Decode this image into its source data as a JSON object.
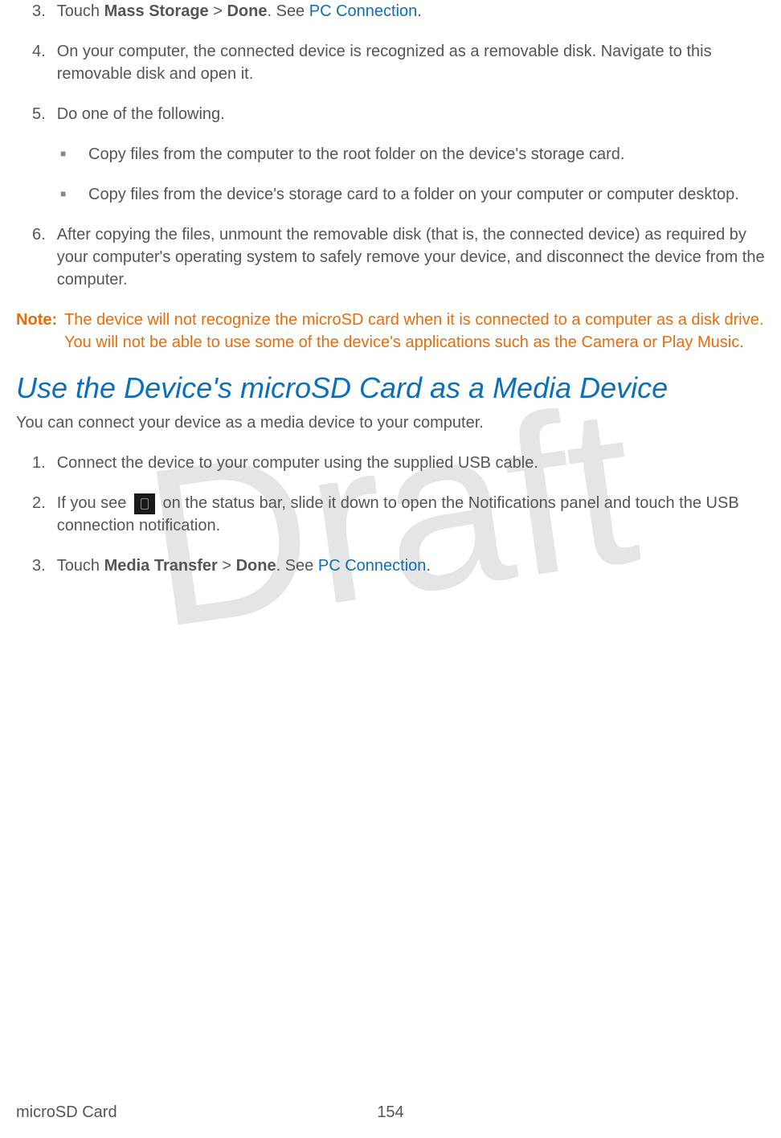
{
  "watermark": "Draft",
  "steps": {
    "s3_num": "3.",
    "s3_prefix": "Touch ",
    "s3_bold1": "Mass Storage",
    "s3_mid": " > ",
    "s3_bold2": "Done",
    "s3_after": ". See ",
    "s3_link": "PC Connection",
    "s3_end": ".",
    "s4_num": "4.",
    "s4_text": "On your computer, the connected device is recognized as a removable disk. Navigate to this removable disk and open it.",
    "s5_num": "5.",
    "s5_text": "Do one of the following.",
    "s5b1": "Copy files from the computer to the root folder on the device's storage card.",
    "s5b2": "Copy files from the device's storage card to a folder on your computer or computer desktop.",
    "s6_num": "6.",
    "s6_text": "After copying the files, unmount the removable disk (that is, the connected device) as required by your computer's operating system to safely remove your device, and disconnect the device from the computer."
  },
  "note": {
    "label": "Note:",
    "text": "The device will not recognize the microSD card when it is connected to a computer as a disk drive. You will not be able to use some of the device's applications such as the Camera or Play Music."
  },
  "heading": "Use the Device's microSD Card as a Media Device",
  "intro": "You can connect your device as a media device to your computer.",
  "steps2": {
    "s1_num": "1.",
    "s1_text": "Connect the device to your computer using the supplied USB cable.",
    "s2_num": "2.",
    "s2_before": "If you see ",
    "s2_after": " on the status bar, slide it down to open the Notifications panel and touch the USB connection notification.",
    "s3_num": "3.",
    "s3_prefix": "Touch ",
    "s3_bold1": "Media Transfer",
    "s3_mid": " > ",
    "s3_bold2": "Done",
    "s3_after": ". See ",
    "s3_link": "PC Connection",
    "s3_end": "."
  },
  "footer": {
    "left": "microSD Card",
    "center": "154"
  }
}
